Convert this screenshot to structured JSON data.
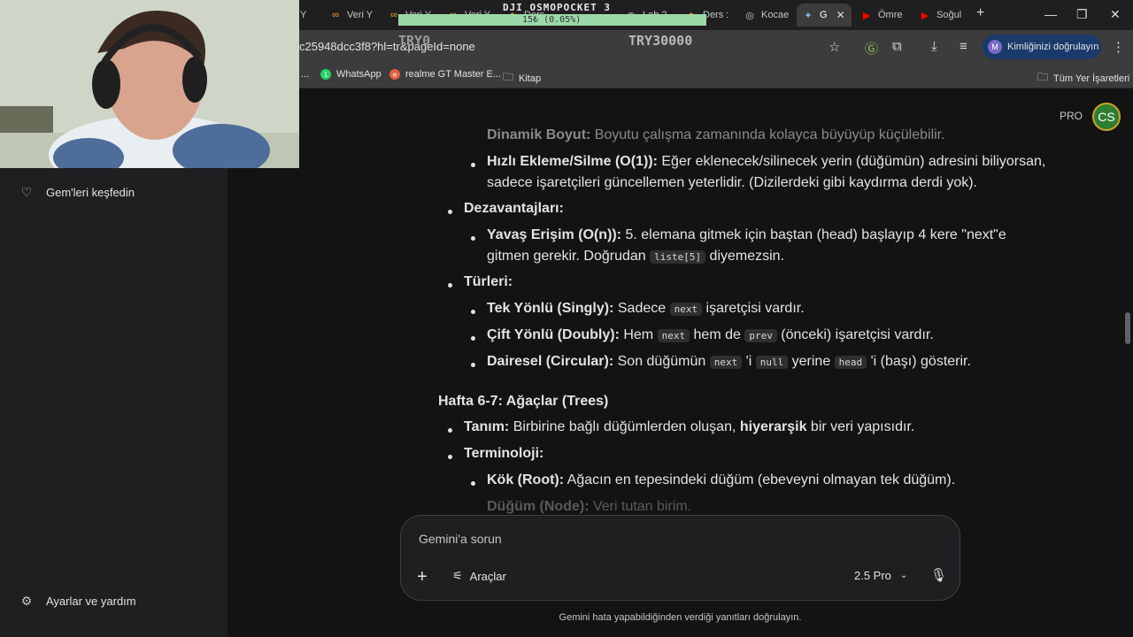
{
  "tabs": [
    {
      "label": "ri Y",
      "icon": "tab-favicon"
    },
    {
      "label": "Veri Y",
      "icon": "infinity-icon"
    },
    {
      "label": "Veri Y",
      "icon": "infinity-icon"
    },
    {
      "label": "Veri Y",
      "icon": "infinity-icon"
    },
    {
      "label": "Ders",
      "icon": "tab-favicon"
    },
    {
      "label": "Lab 2",
      "icon": "github-icon"
    },
    {
      "label": "Ders :",
      "icon": "tab-favicon"
    },
    {
      "label": "Kocae",
      "icon": "globe-icon"
    },
    {
      "label": "G",
      "icon": "gemini-icon"
    },
    {
      "label": "Ömre",
      "icon": "youtube-icon"
    },
    {
      "label": "Soğul",
      "icon": "youtube-icon"
    }
  ],
  "overlay": {
    "device": "DJI OSMOPOCKET 3",
    "change": "15₺ (0.05%)",
    "price_left": "TRY0",
    "price_right": "TRY30000"
  },
  "address": {
    "url": "c25948dcc3f8?hl=tr&pageId=none",
    "verify_label": "Kimliğinizi doğrulayın",
    "verify_initial": "M"
  },
  "bookmarks": [
    {
      "label": "...",
      "icon": ""
    },
    {
      "label": "WhatsApp",
      "icon": "whatsapp-icon"
    },
    {
      "label": "realme GT Master E...",
      "icon": "realme-icon"
    },
    {
      "label": "Kitap",
      "icon": "folder-icon"
    }
  ],
  "bookmarks_all": "Tüm Yer İşaretleri",
  "sidebar": {
    "explore_gems": "Gem'leri keşfedin",
    "settings": "Ayarlar ve yardım"
  },
  "header": {
    "pro_label": "PRO",
    "avatar_initials": "CS"
  },
  "content": {
    "line0_prefix": "Dinamik Boyut:",
    "line0_rest": " Boyutu çalışma zamanında kolayca büyüyüp küçülebilir.",
    "fast_title": "Hızlı Ekleme/Silme (O(1)):",
    "fast_text1": " Eğer eklenecek/silinecek yerin (düğümün) adresini biliyorsan,",
    "fast_text2": "sadece işaretçileri güncellemen yeterlidir. (Dizilerdeki gibi kaydırma derdi yok).",
    "disadv_title": "Dezavantajları:",
    "slow_title": "Yavaş Erişim (O(n)):",
    "slow_text1": " 5. elemana gitmek için baştan (head) başlayıp 4 kere \"next\"e",
    "slow_text2a": "gitmen gerekir. Doğrudan ",
    "slow_code": "liste[5]",
    "slow_text2b": " diyemezsin.",
    "types_title": "Türleri:",
    "singly_title": "Tek Yönlü (Singly):",
    "singly_a": " Sadece ",
    "singly_code": "next",
    "singly_b": " işaretçisi vardır.",
    "doubly_title": "Çift Yönlü (Doubly):",
    "doubly_a": " Hem ",
    "doubly_code1": "next",
    "doubly_b": " hem de ",
    "doubly_code2": "prev",
    "doubly_c": " (önceki) işaretçisi vardır.",
    "circular_title": "Dairesel (Circular):",
    "circular_a": " Son düğümün ",
    "circular_code1": "next",
    "circular_b": " 'i ",
    "circular_code2": "null",
    "circular_c": " yerine ",
    "circular_code3": "head",
    "circular_d": " 'i (başı) gösterir.",
    "week_title": "Hafta 6-7: Ağaçlar (Trees)",
    "def_title": "Tanım:",
    "def_a": " Birbirine bağlı düğümlerden oluşan, ",
    "def_bold": "hiyerarşik",
    "def_b": " bir veri yapısıdır.",
    "term_title": "Terminoloji:",
    "root_title": "Kök (Root):",
    "root_text": " Ağacın en tepesindeki düğüm (ebeveyni olmayan tek düğüm).",
    "node_title": "Düğüm (Node):",
    "node_text": " Veri tutan birim."
  },
  "input": {
    "placeholder": "Gemini'a sorun",
    "tools_label": "Araçlar",
    "model_label": "2.5 Pro",
    "disclaimer": "Gemini hata yapabildiğinden verdiği yanıtları doğrulayın."
  }
}
